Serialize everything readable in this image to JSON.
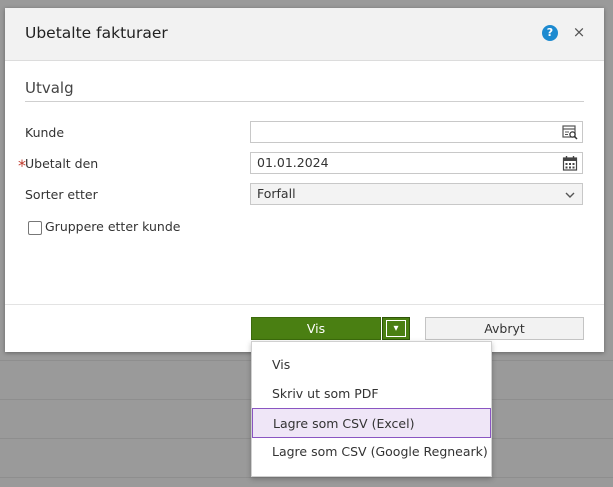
{
  "dialog": {
    "title": "Ubetalte fakturaer",
    "help_icon": "?",
    "close_icon": "×"
  },
  "form": {
    "section_title": "Utvalg",
    "kunde": {
      "label": "Kunde",
      "value": ""
    },
    "ubetalt_den": {
      "required_marker": "*",
      "label": "Ubetalt den",
      "value": "01.01.2024"
    },
    "sorter_etter": {
      "label": "Sorter etter",
      "value": "Forfall"
    },
    "gruppere": {
      "label": "Gruppere etter kunde",
      "checked": false
    }
  },
  "footer": {
    "vis_label": "Vis",
    "dropdown_glyph": "▾",
    "cancel_label": "Avbryt"
  },
  "menu": {
    "items": [
      {
        "label": "Vis"
      },
      {
        "label": "Skriv ut som PDF"
      },
      {
        "label": "Lagre som CSV (Excel)"
      },
      {
        "label": "Lagre som CSV (Google Regneark)"
      }
    ],
    "highlighted_index": 2
  },
  "colors": {
    "primary_green": "#4a7f12",
    "help_blue": "#1d8ad0",
    "highlight_border": "#8a55c2",
    "highlight_bg": "#efe6f7"
  }
}
